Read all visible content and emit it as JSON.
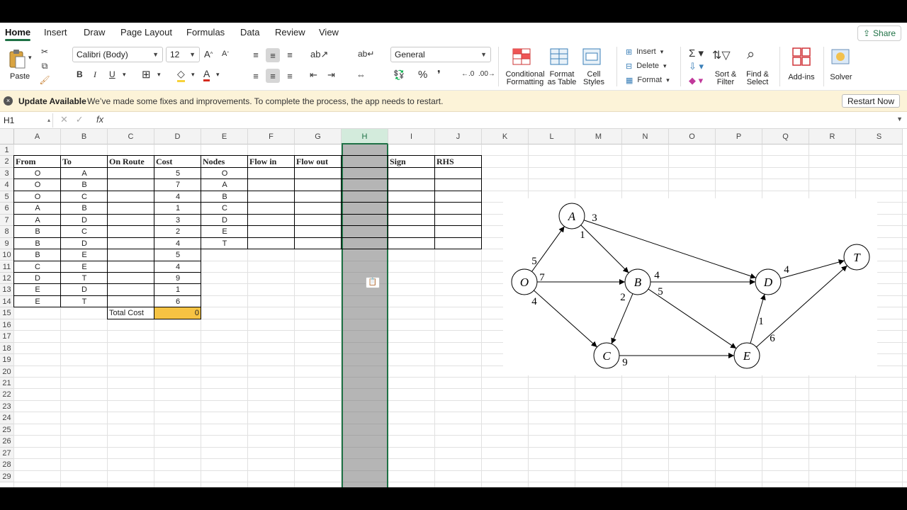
{
  "tabs": [
    "Home",
    "Insert",
    "Draw",
    "Page Layout",
    "Formulas",
    "Data",
    "Review",
    "View"
  ],
  "share_label": "Share",
  "ribbon": {
    "paste": "Paste",
    "font_name": "Calibri (Body)",
    "font_size": "12",
    "number_format": "General",
    "conditional_formatting": [
      "Conditional",
      "Formatting"
    ],
    "format_as_table": [
      "Format",
      "as Table"
    ],
    "cell_styles": [
      "Cell",
      "Styles"
    ],
    "insert": "Insert",
    "delete": "Delete",
    "format": "Format",
    "sort_filter": [
      "Sort &",
      "Filter"
    ],
    "find_select": [
      "Find &",
      "Select"
    ],
    "addins": "Add-ins",
    "solver": "Solver"
  },
  "update": {
    "title": "Update Available",
    "message": "We’ve made some fixes and improvements. To complete the process, the app needs to restart.",
    "button": "Restart Now"
  },
  "formula_bar": {
    "name_box": "H1",
    "fx": "fx",
    "content": ""
  },
  "columns": [
    "A",
    "B",
    "C",
    "D",
    "E",
    "F",
    "G",
    "H",
    "I",
    "J",
    "K",
    "L",
    "M",
    "N",
    "O",
    "P",
    "Q",
    "R",
    "S"
  ],
  "rows_count": 29,
  "sheet": {
    "headers1": [
      "From",
      "To",
      "On Route",
      "Cost"
    ],
    "headers2": [
      "Nodes",
      "Flow in",
      "Flow out"
    ],
    "headers3": [
      "Sign",
      "RHS"
    ],
    "arcs": [
      [
        "O",
        "A",
        "5"
      ],
      [
        "O",
        "B",
        "7"
      ],
      [
        "O",
        "C",
        "4"
      ],
      [
        "A",
        "B",
        "1"
      ],
      [
        "A",
        "D",
        "3"
      ],
      [
        "B",
        "C",
        "2"
      ],
      [
        "B",
        "D",
        "4"
      ],
      [
        "B",
        "E",
        "5"
      ],
      [
        "C",
        "E",
        "4"
      ],
      [
        "D",
        "T",
        "9"
      ],
      [
        "E",
        "D",
        "1"
      ],
      [
        "E",
        "T",
        "6"
      ]
    ],
    "nodes": [
      "O",
      "A",
      "B",
      "C",
      "D",
      "E",
      "T"
    ],
    "total_cost_label": "Total Cost",
    "total_cost_value": "0"
  },
  "network": {
    "nodes": [
      "O",
      "A",
      "B",
      "C",
      "D",
      "E",
      "T"
    ],
    "edge_labels": [
      "5",
      "3",
      "1",
      "7",
      "4",
      "4",
      "2",
      "5",
      "9",
      "4",
      "1",
      "6"
    ]
  },
  "colors": {
    "accent": "#1e7145",
    "total_cost": "#f6c343",
    "update_bar": "#fcf3d8"
  }
}
